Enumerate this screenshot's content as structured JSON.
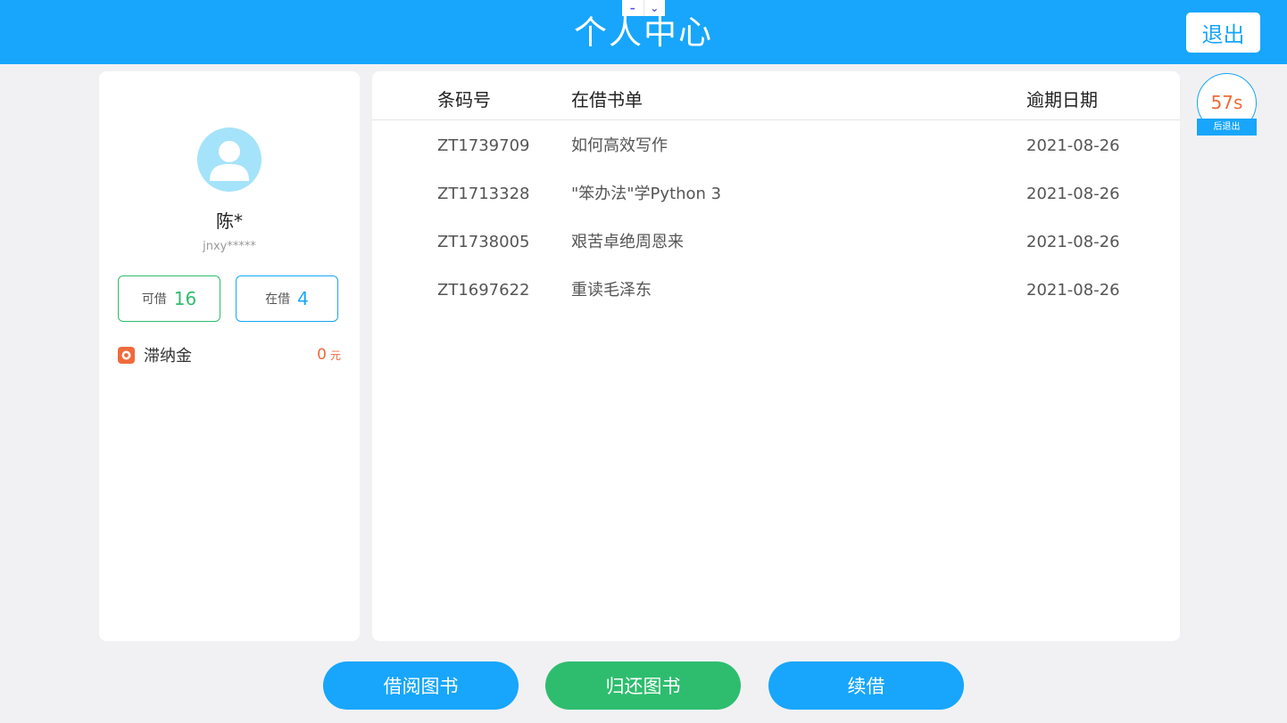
{
  "header": {
    "title": "个人中心",
    "logout_label": "退出",
    "window_controls": [
      "–",
      "⌄"
    ]
  },
  "timer": {
    "value": "57s",
    "label": "后退出"
  },
  "profile": {
    "name": "陈*",
    "user_id": "jnxy*****",
    "available_label": "可借",
    "available_count": "16",
    "borrowed_label": "在借",
    "borrowed_count": "4",
    "fine_label": "滞纳金",
    "fine_amount": "0",
    "fine_unit": "元"
  },
  "books": {
    "columns": [
      "条码号",
      "在借书单",
      "逾期日期"
    ],
    "rows": [
      {
        "barcode": "ZT1739709",
        "title": "如何高效写作",
        "due": "2021-08-26"
      },
      {
        "barcode": "ZT1713328",
        "title": "\"笨办法\"学Python 3",
        "due": "2021-08-26"
      },
      {
        "barcode": "ZT1738005",
        "title": "艰苦卓绝周恩来",
        "due": "2021-08-26"
      },
      {
        "barcode": "ZT1697622",
        "title": "重读毛泽东",
        "due": "2021-08-26"
      }
    ]
  },
  "actions": {
    "borrow_label": "借阅图书",
    "return_label": "归还图书",
    "renew_label": "续借"
  },
  "colors": {
    "primary": "#17a6fb",
    "success": "#2ebd6e",
    "warning": "#f06a3c",
    "background": "#f1f1f3"
  }
}
